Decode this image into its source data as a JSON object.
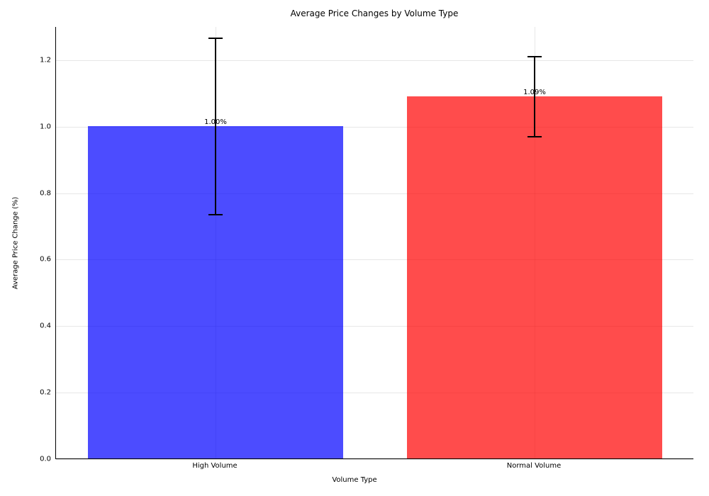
{
  "chart_data": {
    "type": "bar",
    "title": "Average Price Changes by Volume Type",
    "xlabel": "Volume Type",
    "ylabel": "Average Price Change (%)",
    "categories": [
      "High Volume",
      "Normal Volume"
    ],
    "values": [
      1.0,
      1.09
    ],
    "errors": [
      0.265,
      0.12
    ],
    "value_labels": [
      "1.00%",
      "1.09%"
    ],
    "colors": [
      "#0000ff",
      "#ff0000"
    ],
    "alpha": 0.7,
    "ylim": [
      0.0,
      1.3
    ],
    "yticks": [
      0.0,
      0.2,
      0.4,
      0.6,
      0.8,
      1.0,
      1.2
    ],
    "ytick_labels": [
      "0.0",
      "0.2",
      "0.4",
      "0.6",
      "0.8",
      "1.0",
      "1.2"
    ],
    "grid": true,
    "capsize_px": 10
  }
}
